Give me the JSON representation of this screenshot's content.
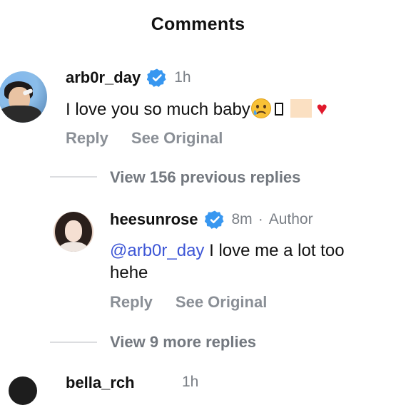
{
  "header": {
    "title": "Comments"
  },
  "comment": {
    "username": "arb0r_day",
    "time": "1h",
    "text": "I love you so much baby",
    "emoji_tofu": "□",
    "heart": "♥",
    "reply_label": "Reply",
    "see_original_label": "See Original",
    "view_previous_label": "View 156 previous replies"
  },
  "reply": {
    "username": "heesunrose",
    "time": "8m",
    "separator": "·",
    "author_label": "Author",
    "mention": "@arb0r_day",
    "text_line1": " I love me a lot too",
    "text_line2": "hehe",
    "reply_label": "Reply",
    "see_original_label": "See Original",
    "view_more_label": "View 9 more replies"
  },
  "next_comment": {
    "username": "bella_rch",
    "time": "1h"
  },
  "colors": {
    "verified": "#3897f0",
    "mention": "#3d56d6",
    "heart": "#e0182b"
  },
  "icons": [
    "verified-badge-icon",
    "crying-face-emoji",
    "heart-emoji"
  ]
}
